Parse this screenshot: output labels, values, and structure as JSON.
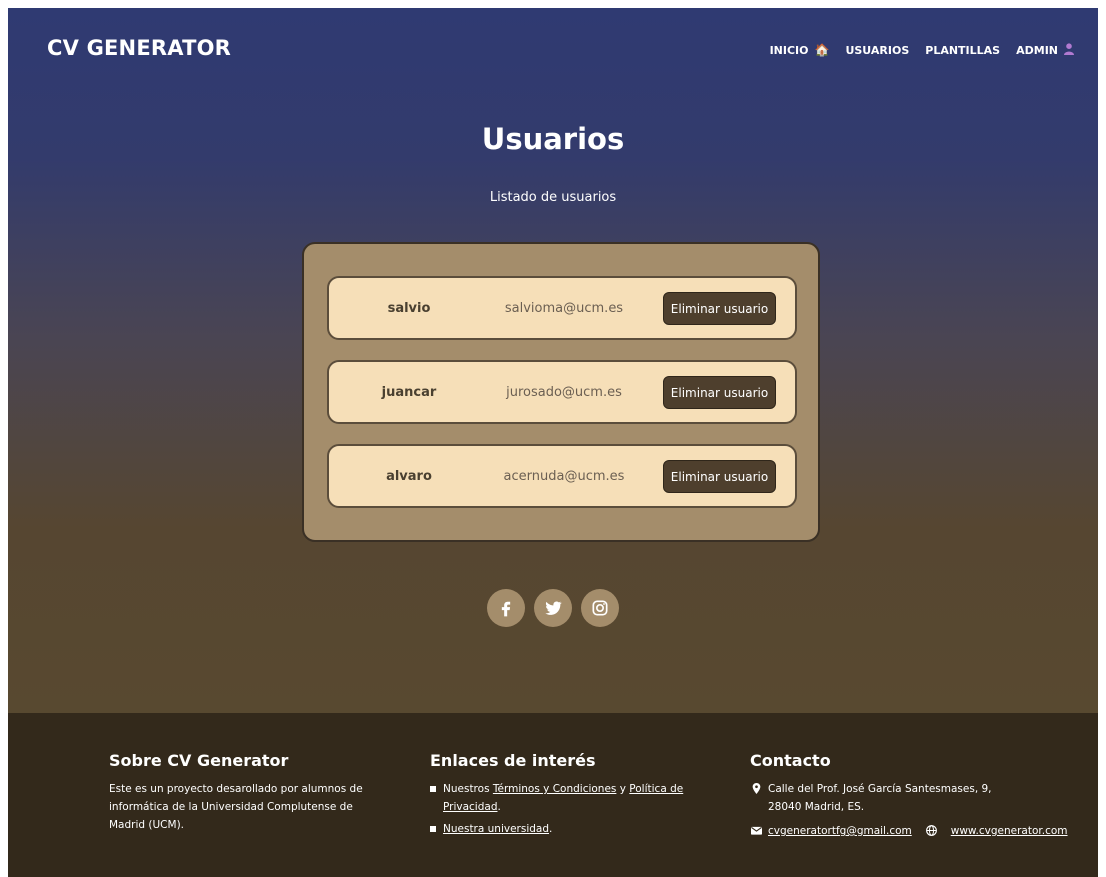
{
  "brand": "CV GENERATOR",
  "nav": [
    {
      "label": "INICIO",
      "icon": "home-icon"
    },
    {
      "label": "USUARIOS"
    },
    {
      "label": "PLANTILLAS"
    },
    {
      "label": "ADMIN",
      "icon": "person-icon"
    }
  ],
  "page": {
    "title": "Usuarios",
    "subtitle": "Listado de usuarios"
  },
  "users": [
    {
      "name": "salvio",
      "email": "salvioma@ucm.es",
      "action": "Eliminar usuario"
    },
    {
      "name": "juancar",
      "email": "jurosado@ucm.es",
      "action": "Eliminar usuario"
    },
    {
      "name": "alvaro",
      "email": "acernuda@ucm.es",
      "action": "Eliminar usuario"
    }
  ],
  "social": [
    {
      "icon": "facebook-icon"
    },
    {
      "icon": "twitter-icon"
    },
    {
      "icon": "instagram-icon"
    }
  ],
  "footer": {
    "about": {
      "title": "Sobre CV Generator",
      "text": "Este es un proyecto desarollado por alumnos de informática de la Universidad Complutense de Madrid (UCM)."
    },
    "links": {
      "title": "Enlaces de interés",
      "item1_prefix": "Nuestros",
      "terms": "Términos y Condiciones",
      "item1_and": "y",
      "privacy": "Política de Privacidad",
      "university": "Nuestra universidad",
      "period": "."
    },
    "contact": {
      "title": "Contacto",
      "address_line1": "Calle del Prof. José García Santesmases, 9,",
      "address_line2": "28040 Madrid, ES.",
      "email": "cvgeneratortfg@gmail.com",
      "website": "www.cvgenerator.com"
    }
  },
  "colors": {
    "hero_top": "#2f3a72",
    "hero_bottom": "#584930",
    "panel": "#a48d6b",
    "card": "#f6dfb8",
    "button": "#4e3f2d",
    "footer": "#33291b"
  }
}
